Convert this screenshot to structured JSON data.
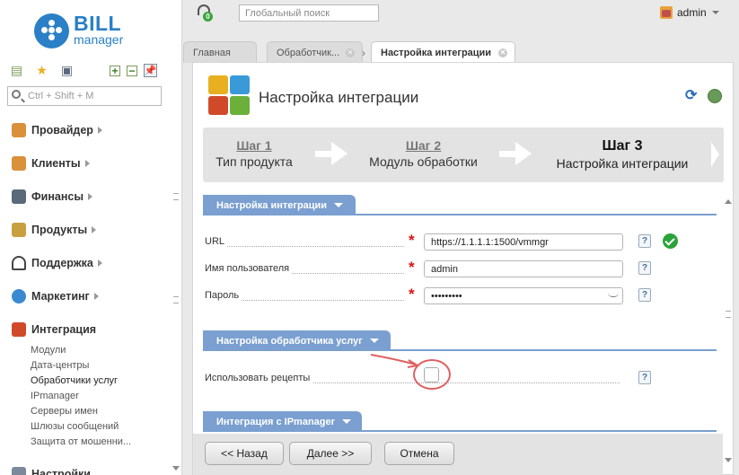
{
  "logo": {
    "bill": "BILL",
    "manager": "manager",
    "brand_color": "#2a7fc6"
  },
  "left_search": {
    "placeholder": "Ctrl + Shift + M"
  },
  "left_toolbar": {
    "plus": "+",
    "minus": "−"
  },
  "menu": [
    {
      "label": "Провайдер",
      "icon": "provider-icon",
      "color": "#d9913a"
    },
    {
      "label": "Клиенты",
      "icon": "clients-icon",
      "color": "#d9913a"
    },
    {
      "label": "Финансы",
      "icon": "finance-icon",
      "color": "#5a6a7a"
    },
    {
      "label": "Продукты",
      "icon": "products-icon",
      "color": "#c8a040"
    },
    {
      "label": "Поддержка",
      "icon": "support-icon",
      "color": "#444"
    },
    {
      "label": "Маркетинг",
      "icon": "marketing-icon",
      "color": "#3a8ad0"
    },
    {
      "label": "Интеграция",
      "icon": "integration-icon",
      "color": "#d04a2a"
    },
    {
      "label": "Настройки",
      "icon": "settings-icon",
      "color": "#7a8a9a"
    }
  ],
  "submenu": [
    {
      "label": "Модули"
    },
    {
      "label": "Дата-центры"
    },
    {
      "label": "Обработчики услуг",
      "active": true
    },
    {
      "label": "IPmanager"
    },
    {
      "label": "Серверы имен"
    },
    {
      "label": "Шлюзы сообщений"
    },
    {
      "label": "Защита от мошенни..."
    }
  ],
  "topbar": {
    "support_badge": "0",
    "search_placeholder": "Глобальный поиск",
    "username": "admin"
  },
  "tabs": [
    {
      "label": "Главная"
    },
    {
      "label": "Обработчик..."
    },
    {
      "label": "Настройка интеграции",
      "active": true
    }
  ],
  "tab_separator": "›",
  "page": {
    "title": "Настройка интеграции",
    "refresh_icon": "⟳"
  },
  "wizard": [
    {
      "num": "Шаг 1",
      "desc": "Тип продукта"
    },
    {
      "num": "Шаг 2",
      "desc": "Модуль обработки"
    },
    {
      "num": "Шаг 3",
      "desc": "Настройка интеграции",
      "current": true
    }
  ],
  "sections": {
    "integration": "Настройка интеграции",
    "handler": "Настройка обработчика услуг",
    "ipmanager": "Интеграция с IPmanager"
  },
  "fields": {
    "url": {
      "label": "URL",
      "value": "https://1.1.1.1:1500/vmmgr",
      "required": "*"
    },
    "username": {
      "label": "Имя пользователя",
      "value": "admin",
      "required": "*"
    },
    "password": {
      "label": "Пароль",
      "value": "•••••••••",
      "required": "*"
    },
    "recipes": {
      "label": "Использовать рецепты"
    }
  },
  "help_mark": "?",
  "buttons": {
    "back": "<< Назад",
    "next": "Далее >>",
    "cancel": "Отмена"
  },
  "colors": {
    "section_header": "#7a9fd0",
    "required": "#dd1111",
    "ok": "#2aa43a",
    "annotation": "#e06060"
  }
}
